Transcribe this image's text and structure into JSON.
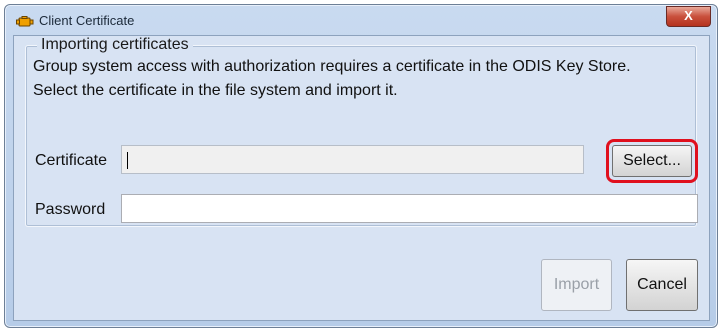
{
  "window": {
    "title": "Client Certificate",
    "close_label": "X",
    "app_icon": "engine-icon"
  },
  "import_group": {
    "legend": "Importing certificates",
    "line1": "Group system access with authorization requires a certificate in the ODIS Key Store.",
    "line2": "Select the certificate in the file system and import it."
  },
  "fields": {
    "certificate_label": "Certificate",
    "certificate_value": "",
    "password_label": "Password",
    "password_value": ""
  },
  "buttons": {
    "select_label": "Select...",
    "import_label": "Import",
    "cancel_label": "Cancel"
  },
  "colors": {
    "highlight": "#e0101e",
    "accent_icon": "#f0a000"
  }
}
